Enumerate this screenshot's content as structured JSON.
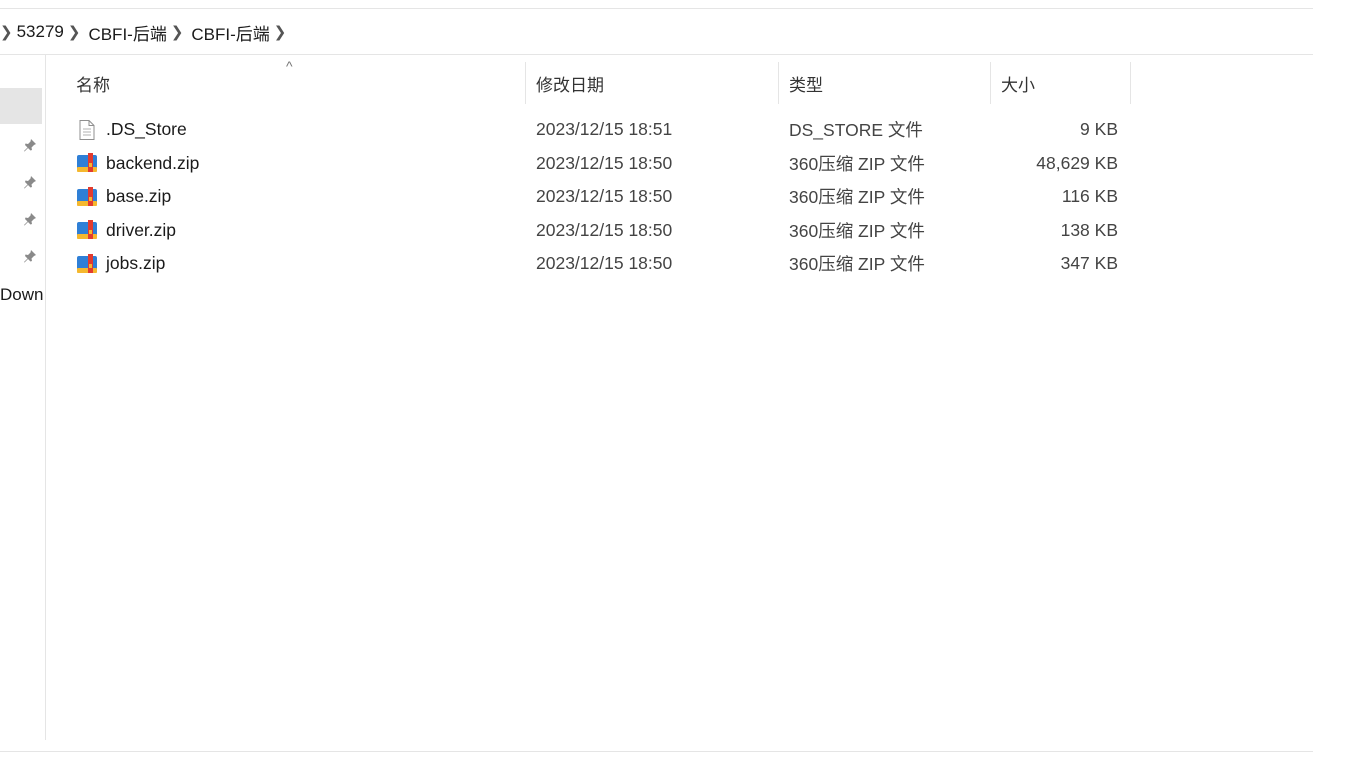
{
  "breadcrumb": {
    "items": [
      "53279",
      "CBFI-后端",
      "CBFI-后端"
    ]
  },
  "nav": {
    "pinned_count": 4,
    "downloads_label": "Down"
  },
  "columns": {
    "name": "名称",
    "date": "修改日期",
    "type": "类型",
    "size": "大小",
    "sort_indicator": "^"
  },
  "files": [
    {
      "name": ".DS_Store",
      "date": "2023/12/15 18:51",
      "type": "DS_STORE 文件",
      "size": "9 KB",
      "icon": "document-icon"
    },
    {
      "name": "backend.zip",
      "date": "2023/12/15 18:50",
      "type": "360压缩 ZIP 文件",
      "size": "48,629 KB",
      "icon": "zip-archive-icon"
    },
    {
      "name": "base.zip",
      "date": "2023/12/15 18:50",
      "type": "360压缩 ZIP 文件",
      "size": "116 KB",
      "icon": "zip-archive-icon"
    },
    {
      "name": "driver.zip",
      "date": "2023/12/15 18:50",
      "type": "360压缩 ZIP 文件",
      "size": "138 KB",
      "icon": "zip-archive-icon"
    },
    {
      "name": "jobs.zip",
      "date": "2023/12/15 18:50",
      "type": "360压缩 ZIP 文件",
      "size": "347 KB",
      "icon": "zip-archive-icon"
    }
  ],
  "colors": {
    "zip_blue": "#2f7fd6",
    "zip_yellow": "#f5b82e",
    "zip_red": "#e23b2f",
    "divider": "#e5e5e5"
  }
}
